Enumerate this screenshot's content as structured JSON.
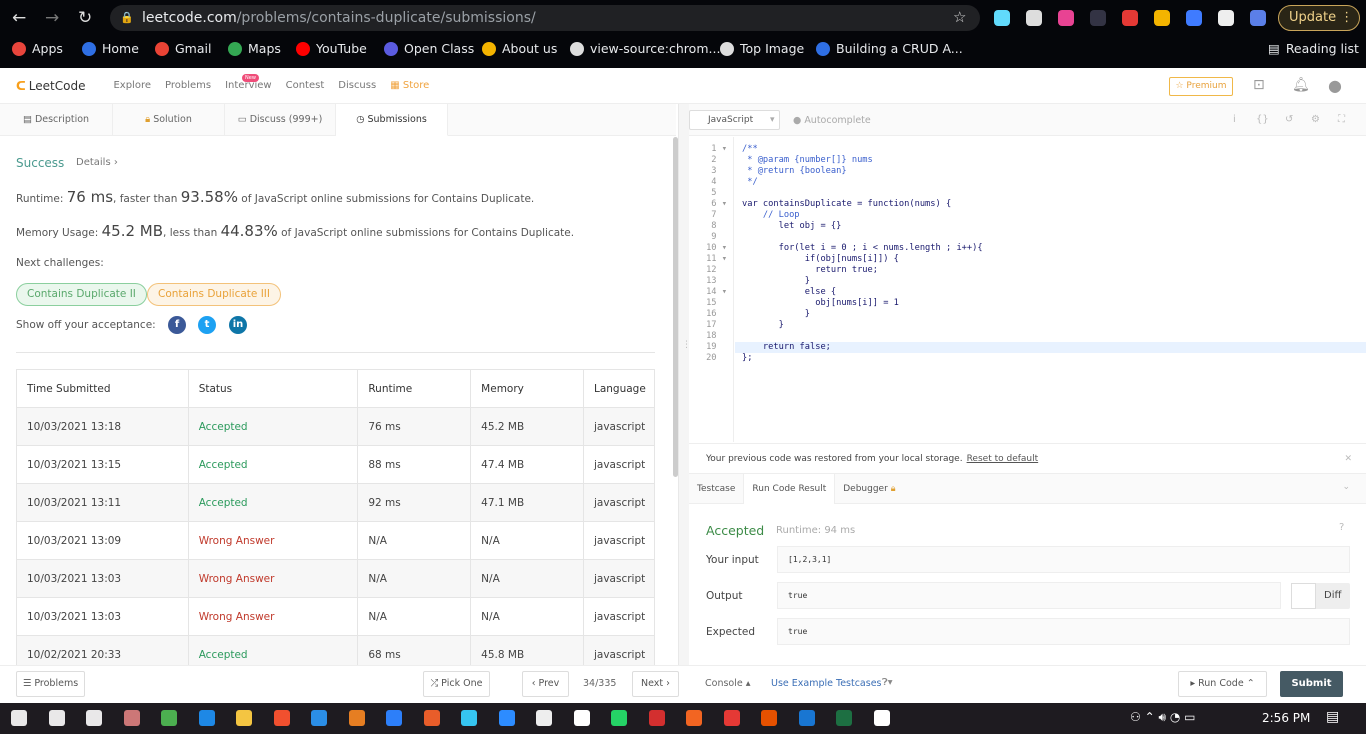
{
  "browser": {
    "url_host": "leetcode.com",
    "url_path": "/problems/contains-duplicate/submissions/",
    "update_label": "Update",
    "bookmarks": [
      {
        "label": "Apps",
        "color": "#e8453c"
      },
      {
        "label": "Home",
        "color": "#2f6fe4"
      },
      {
        "label": "Gmail",
        "color": "#ea4335"
      },
      {
        "label": "Maps",
        "color": "#34a853"
      },
      {
        "label": "YouTube",
        "color": "#ff0000"
      },
      {
        "label": "Open Class",
        "color": "#5b5be0"
      },
      {
        "label": "About us",
        "color": "#f4b400"
      },
      {
        "label": "view-source:chrom...",
        "color": "#ddd"
      },
      {
        "label": "Top Image",
        "color": "#ddd"
      },
      {
        "label": "Building a CRUD A...",
        "color": "#2f6fe4"
      }
    ],
    "reading_list": "Reading list"
  },
  "nav": {
    "logo": "LeetCode",
    "items": [
      "Explore",
      "Problems",
      "Interview",
      "Contest",
      "Discuss",
      "Store"
    ],
    "new_badge": "New",
    "premium": "☆ Premium"
  },
  "left_tabs": [
    "Description",
    "Solution",
    "Discuss (999+)",
    "Submissions"
  ],
  "result": {
    "status": "Success",
    "details": "Details ›",
    "runtime_label": "Runtime: ",
    "runtime": "76 ms",
    "runtime_mid": ", faster than ",
    "runtime_pct": "93.58%",
    "runtime_tail": " of JavaScript online submissions for Contains Duplicate.",
    "memory_label": "Memory Usage: ",
    "memory": "45.2 MB",
    "memory_mid": ", less than ",
    "memory_pct": "44.83%",
    "memory_tail": " of JavaScript online submissions for Contains Duplicate.",
    "next_label": "Next challenges:",
    "challenges": [
      "Contains Duplicate II",
      "Contains Duplicate III"
    ],
    "share_label": "Show off your acceptance:"
  },
  "table": {
    "headers": [
      "Time Submitted",
      "Status",
      "Runtime",
      "Memory",
      "Language"
    ],
    "rows": [
      [
        "10/03/2021 13:18",
        "Accepted",
        "76 ms",
        "45.2 MB",
        "javascript"
      ],
      [
        "10/03/2021 13:15",
        "Accepted",
        "88 ms",
        "47.4 MB",
        "javascript"
      ],
      [
        "10/03/2021 13:11",
        "Accepted",
        "92 ms",
        "47.1 MB",
        "javascript"
      ],
      [
        "10/03/2021 13:09",
        "Wrong Answer",
        "N/A",
        "N/A",
        "javascript"
      ],
      [
        "10/03/2021 13:03",
        "Wrong Answer",
        "N/A",
        "N/A",
        "javascript"
      ],
      [
        "10/03/2021 13:03",
        "Wrong Answer",
        "N/A",
        "N/A",
        "javascript"
      ],
      [
        "10/02/2021 20:33",
        "Accepted",
        "68 ms",
        "45.8 MB",
        "javascript"
      ]
    ]
  },
  "editor": {
    "language": "JavaScript",
    "autocomplete": "Autocomplete",
    "lines": [
      "/**",
      " * @param {number[]} nums",
      " * @return {boolean}",
      " */",
      "",
      "var containsDuplicate = function(nums) {",
      "    // Loop",
      "       let obj = {}",
      "",
      "       for(let i = 0 ; i < nums.length ; i++){",
      "            if(obj[nums[i]]) {",
      "              return true;",
      "            }",
      "            else {",
      "              obj[nums[i]] = 1",
      "            }",
      "       }",
      "",
      "    return false;",
      "};"
    ]
  },
  "console": {
    "restored": "Your previous code was restored from your local storage.",
    "reset": "Reset to default",
    "tabs": [
      "Testcase",
      "Run Code Result",
      "Debugger"
    ],
    "status": "Accepted",
    "runtime": "Runtime: 94 ms",
    "input_label": "Your input",
    "input": "[1,2,3,1]",
    "output_label": "Output",
    "output": "true",
    "expected_label": "Expected",
    "expected": "true",
    "diff": "Diff"
  },
  "bottom": {
    "problems": "☰ Problems",
    "pick_one": "⤮ Pick One",
    "prev": "‹ Prev",
    "page": "34/335",
    "next": "Next ›",
    "console": "Console ▴",
    "use_example": "Use Example Testcases",
    "run_code": "▸ Run Code ⌃",
    "submit": "Submit"
  },
  "taskbar": {
    "time": "2:56 PM"
  }
}
